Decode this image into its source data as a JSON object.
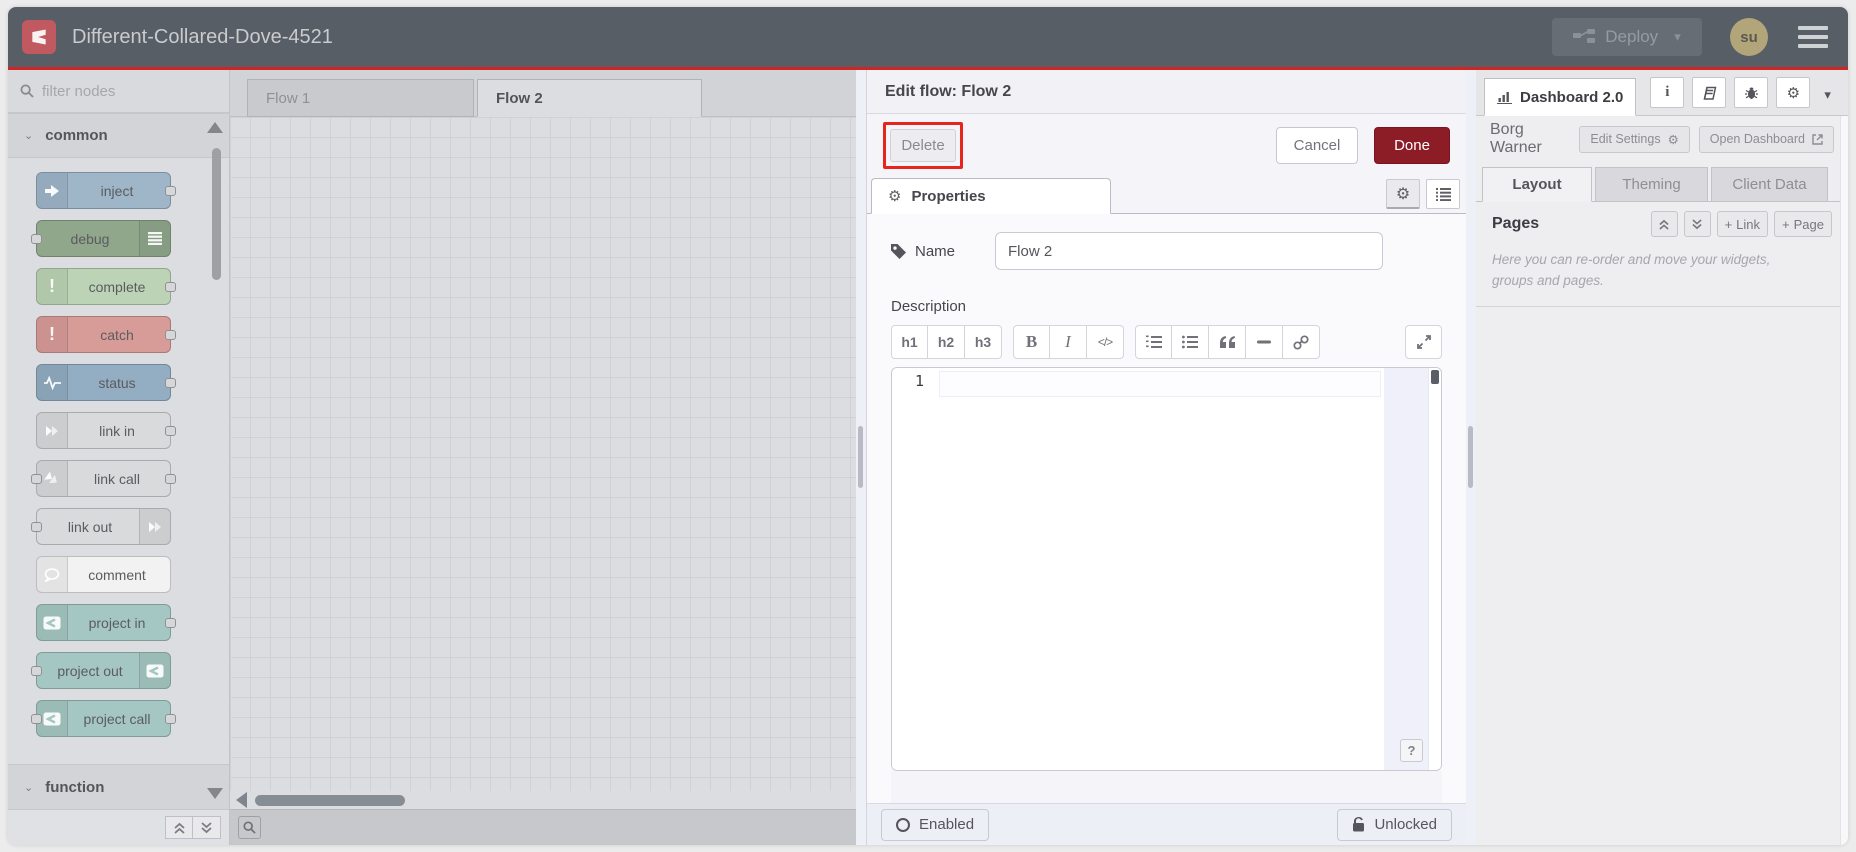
{
  "header": {
    "title": "Different-Collared-Dove-4521",
    "deploy_label": "Deploy",
    "avatar_text": "su"
  },
  "palette": {
    "search_placeholder": "filter nodes",
    "category_common": "common",
    "category_function": "function",
    "nodes": [
      {
        "label": "inject",
        "color": "#9fb6c9",
        "icon": "inject-arrow-icon"
      },
      {
        "label": "debug",
        "color": "#90a78c",
        "icon": "debug-lines-icon"
      },
      {
        "label": "complete",
        "color": "#bcd4b5",
        "icon": "exclamation-icon"
      },
      {
        "label": "catch",
        "color": "#d89c98",
        "icon": "exclamation-icon"
      },
      {
        "label": "status",
        "color": "#93adc2",
        "icon": "status-wave-icon"
      },
      {
        "label": "link in",
        "color": "#d8dadc",
        "icon": "link-chevrons-icon"
      },
      {
        "label": "link call",
        "color": "#d8dadc",
        "icon": "link-chevrons-icon"
      },
      {
        "label": "link out",
        "color": "#d8dadc",
        "icon": "link-chevrons-icon"
      },
      {
        "label": "comment",
        "color": "#f2f2f3",
        "icon": "comment-bubble-icon"
      },
      {
        "label": "project in",
        "color": "#a5c7c3",
        "icon": "project-node-icon"
      },
      {
        "label": "project out",
        "color": "#a5c7c3",
        "icon": "project-node-icon"
      },
      {
        "label": "project call",
        "color": "#a5c7c3",
        "icon": "project-node-icon"
      }
    ]
  },
  "workspace": {
    "tabs": [
      {
        "label": "Flow 1"
      },
      {
        "label": "Flow 2"
      }
    ]
  },
  "dialog": {
    "title": "Edit flow: Flow 2",
    "delete_label": "Delete",
    "cancel_label": "Cancel",
    "done_label": "Done",
    "properties_tab": "Properties",
    "name_label": "Name",
    "name_value": "Flow 2",
    "description_label": "Description",
    "md_buttons": {
      "h1": "h1",
      "h2": "h2",
      "h3": "h3",
      "bold": "B",
      "italic": "I",
      "code": "</>"
    },
    "editor": {
      "line_number": "1",
      "help_label": "?"
    },
    "enabled_label": "Enabled",
    "unlocked_label": "Unlocked"
  },
  "sidebar": {
    "tab_label": "Dashboard 2.0",
    "project_name": "Borg Warner",
    "edit_settings_label": "Edit Settings",
    "open_dashboard_label": "Open Dashboard",
    "tabs": [
      {
        "label": "Layout"
      },
      {
        "label": "Theming"
      },
      {
        "label": "Client Data"
      }
    ],
    "pages_title": "Pages",
    "add_link_label": "Link",
    "add_page_label": "Page",
    "help_text": "Here you can re-order and move your widgets, groups and pages."
  },
  "icons": {
    "gear": "⚙",
    "caret_down": "▾",
    "exclamation": "!",
    "plus": "+",
    "info": "i"
  },
  "colors": {
    "header_bg": "#585e66",
    "accent_red_line": "#cf2525",
    "annotation_red": "#e8251d",
    "done_red": "#8c1c26",
    "logo_red": "#c05a60",
    "avatar_tan": "#b3a57a"
  }
}
